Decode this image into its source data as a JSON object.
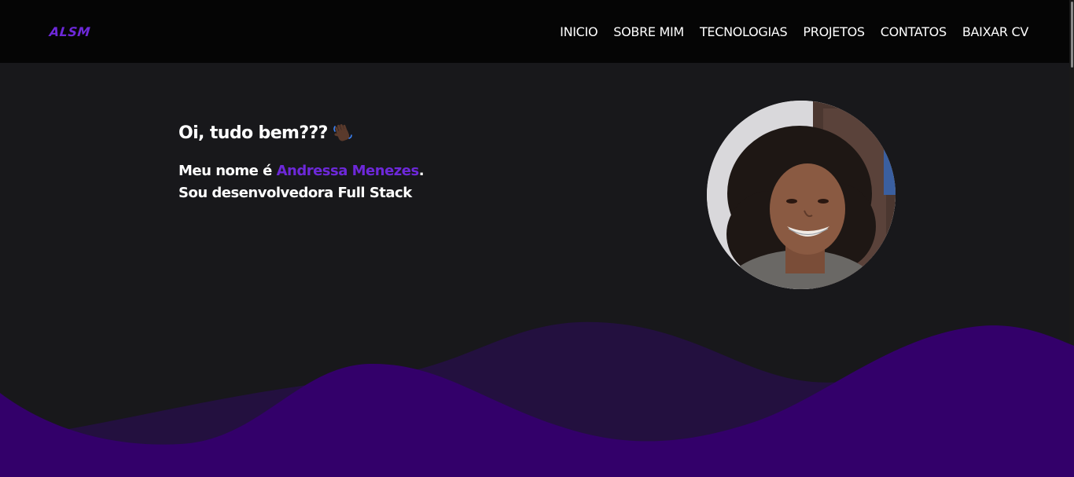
{
  "header": {
    "logo": "ALSM",
    "nav": [
      "INICIO",
      "SOBRE MIM",
      "TECNOLOGIAS",
      "PROJETOS",
      "CONTATOS",
      "BAIXAR CV"
    ]
  },
  "hero": {
    "greeting": "Oi, tudo bem???",
    "greeting_icon": "waving-hand-icon",
    "intro_prefix": "Meu nome é ",
    "intro_name": "Andressa Menezes",
    "intro_suffix": ".",
    "intro_line2": "Sou desenvolvedora Full Stack"
  },
  "colors": {
    "background": "#18181b",
    "header": "#050505",
    "accent": "#6d28d9",
    "wave_dark": "#23103f",
    "wave_main": "#33006a"
  }
}
